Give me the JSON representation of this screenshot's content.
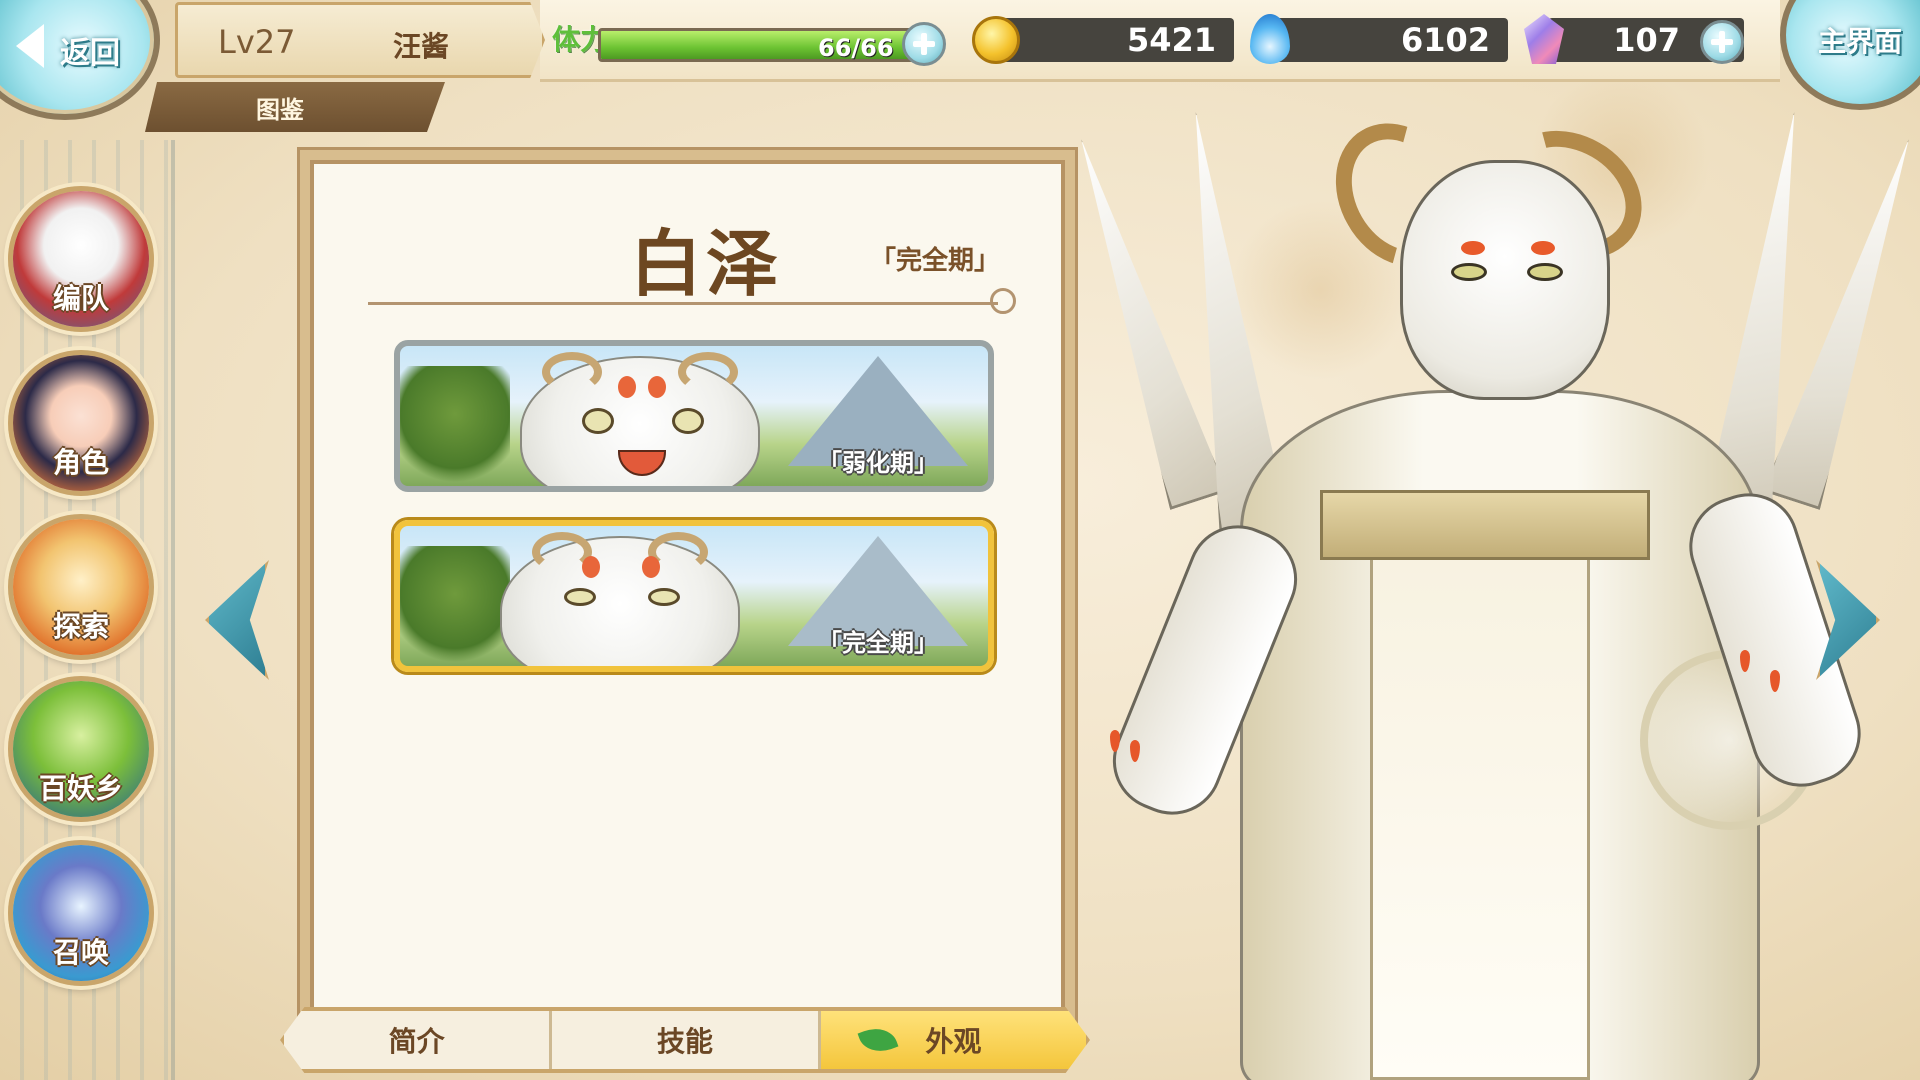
{
  "header": {
    "back_label": "返回",
    "level": "Lv27",
    "player_name": "汪酱",
    "section": "图鉴",
    "home_label": "主界面"
  },
  "resources": {
    "stamina_label": "体力",
    "stamina_text": "66/66",
    "stamina_fraction": 1.0,
    "gold": "5421",
    "soul_fire": "6102",
    "gems": "107"
  },
  "nav": {
    "items": [
      {
        "label": "编队",
        "icon": "team-ghost-icon"
      },
      {
        "label": "角色",
        "icon": "character-girl-icon"
      },
      {
        "label": "探索",
        "icon": "explore-scroll-icon"
      },
      {
        "label": "百妖乡",
        "icon": "village-house-icon"
      },
      {
        "label": "召唤",
        "icon": "summon-swirl-icon"
      }
    ]
  },
  "panel": {
    "title": "白泽",
    "stage": "「完全期」",
    "cards": [
      {
        "stage_label": "「弱化期」",
        "selected": false
      },
      {
        "stage_label": "「完全期」",
        "selected": true
      }
    ]
  },
  "tabs": [
    {
      "label": "简介",
      "active": false
    },
    {
      "label": "技能",
      "active": false
    },
    {
      "label": "外观",
      "active": true
    }
  ],
  "colors": {
    "accent_gold": "#f1c33c",
    "stamina_green": "#6cc332",
    "title_brown": "#6d4721",
    "orb_teal": "#6cc7d3"
  }
}
